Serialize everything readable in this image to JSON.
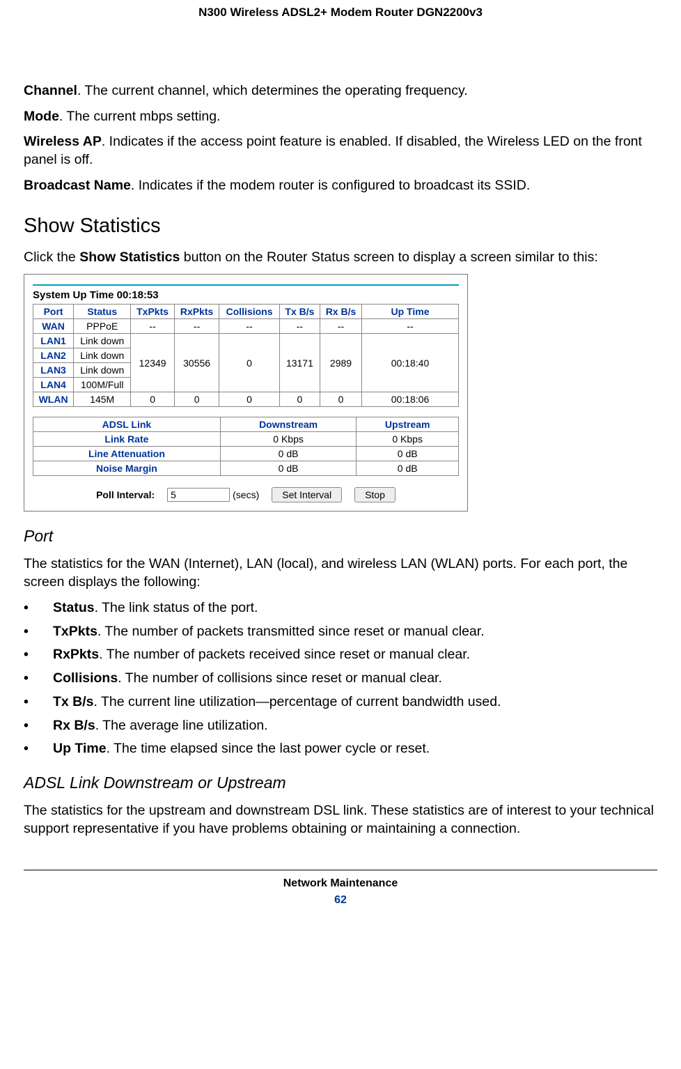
{
  "header": {
    "title": "N300 Wireless ADSL2+ Modem Router DGN2200v3"
  },
  "defs": {
    "channel": {
      "term": "Channel",
      "text": ". The current channel, which determines the operating frequency."
    },
    "mode": {
      "term": "Mode",
      "text": ". The current mbps setting."
    },
    "wirelessAP": {
      "term": "Wireless AP",
      "text": ". Indicates if the access point feature is enabled. If disabled, the Wireless LED on the front panel is off."
    },
    "broadcast": {
      "term": "Broadcast Name",
      "text": ". Indicates if the modem router is configured to broadcast its SSID."
    }
  },
  "showStats": {
    "heading": "Show Statistics",
    "intro_a": "Click the ",
    "intro_b": "Show Statistics",
    "intro_c": " button on the Router Status screen to display a screen similar to this:"
  },
  "shot": {
    "sysUpLabel": "System Up Time ",
    "sysUpValue": "00:18:53",
    "cols": {
      "port": "Port",
      "status": "Status",
      "txpkts": "TxPkts",
      "rxpkts": "RxPkts",
      "coll": "Collisions",
      "txbs": "Tx B/s",
      "rxbs": "Rx B/s",
      "uptime": "Up Time"
    },
    "wan": {
      "port": "WAN",
      "status": "PPPoE",
      "txpkts": "--",
      "rxpkts": "--",
      "coll": "--",
      "txbs": "--",
      "rxbs": "--",
      "uptime": "--"
    },
    "lan1": {
      "port": "LAN1",
      "status": "Link down"
    },
    "lan2": {
      "port": "LAN2",
      "status": "Link down"
    },
    "lan3": {
      "port": "LAN3",
      "status": "Link down"
    },
    "lan4": {
      "port": "LAN4",
      "status": "100M/Full"
    },
    "lanGroup": {
      "txpkts": "12349",
      "rxpkts": "30556",
      "coll": "0",
      "txbs": "13171",
      "rxbs": "2989",
      "uptime": "00:18:40"
    },
    "wlan": {
      "port": "WLAN",
      "status": "145M",
      "txpkts": "0",
      "rxpkts": "0",
      "coll": "0",
      "txbs": "0",
      "rxbs": "0",
      "uptime": "00:18:06"
    },
    "adslCols": {
      "link": "ADSL Link",
      "down": "Downstream",
      "up": "Upstream"
    },
    "adslRows": {
      "linkRate": {
        "label": "Link Rate",
        "down": "0 Kbps",
        "up": "0 Kbps"
      },
      "lineAtt": {
        "label": "Line Attenuation",
        "down": "0 dB",
        "up": "0 dB"
      },
      "noise": {
        "label": "Noise Margin",
        "down": "0 dB",
        "up": "0 dB"
      }
    },
    "poll": {
      "label": "Poll Interval:",
      "value": "5",
      "secs": "(secs)",
      "setBtn": "Set Interval",
      "stopBtn": "Stop"
    }
  },
  "port": {
    "heading": "Port",
    "intro": "The statistics for the WAN (Internet), LAN (local), and wireless LAN (WLAN) ports. For each port, the screen displays the following:",
    "items": {
      "status": {
        "term": "Status",
        "text": ". The link status of the port."
      },
      "txpkts": {
        "term": "TxPkts",
        "text": ". The number of packets transmitted since reset or manual clear."
      },
      "rxpkts": {
        "term": "RxPkts",
        "text": ". The number of packets received since reset or manual clear."
      },
      "coll": {
        "term": "Collisions",
        "text": ". The number of collisions since reset or manual clear."
      },
      "txbs": {
        "term": "Tx B/s",
        "text": ". The current line utilization—percentage of current bandwidth used."
      },
      "rxbs": {
        "term": "Rx B/s",
        "text": ". The average line utilization."
      },
      "uptime": {
        "term": "Up Time",
        "text": ". The time elapsed since the last power cycle or reset."
      }
    }
  },
  "adslSection": {
    "heading": "ADSL Link Downstream or Upstream",
    "text": "The statistics for the upstream and downstream DSL link. These statistics are of interest to your technical support representative if you have problems obtaining or maintaining a connection."
  },
  "footer": {
    "section": "Network Maintenance",
    "page": "62"
  }
}
